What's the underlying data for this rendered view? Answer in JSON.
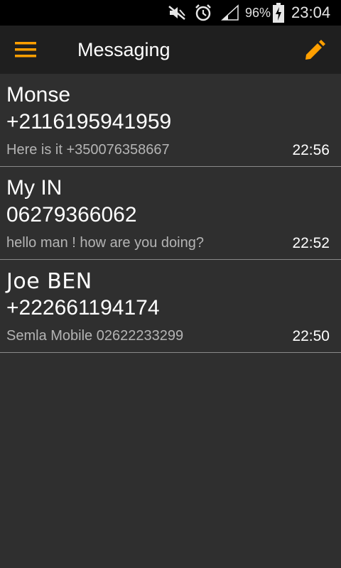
{
  "status_bar": {
    "battery_percent": "96%",
    "clock": "23:04",
    "icons": [
      "muted-icon",
      "alarm-icon",
      "signal-icon",
      "battery-charging-icon"
    ]
  },
  "app_bar": {
    "title": "Messaging",
    "menu_icon": "hamburger-menu-icon",
    "compose_icon": "pencil-icon",
    "accent_color": "#ff9f00"
  },
  "threads": [
    {
      "name": "Monse",
      "number": "+2116195941959",
      "snippet": "Here is it +350076358667",
      "time": "22:56"
    },
    {
      "name": "My IN",
      "number": "06279366062",
      "snippet": "hello man ! how are you doing?",
      "time": "22:52"
    },
    {
      "name": "Joe BEN",
      "number": "+222661194174",
      "snippet": "Semla  Mobile 02622233299",
      "time": "22:50"
    }
  ]
}
